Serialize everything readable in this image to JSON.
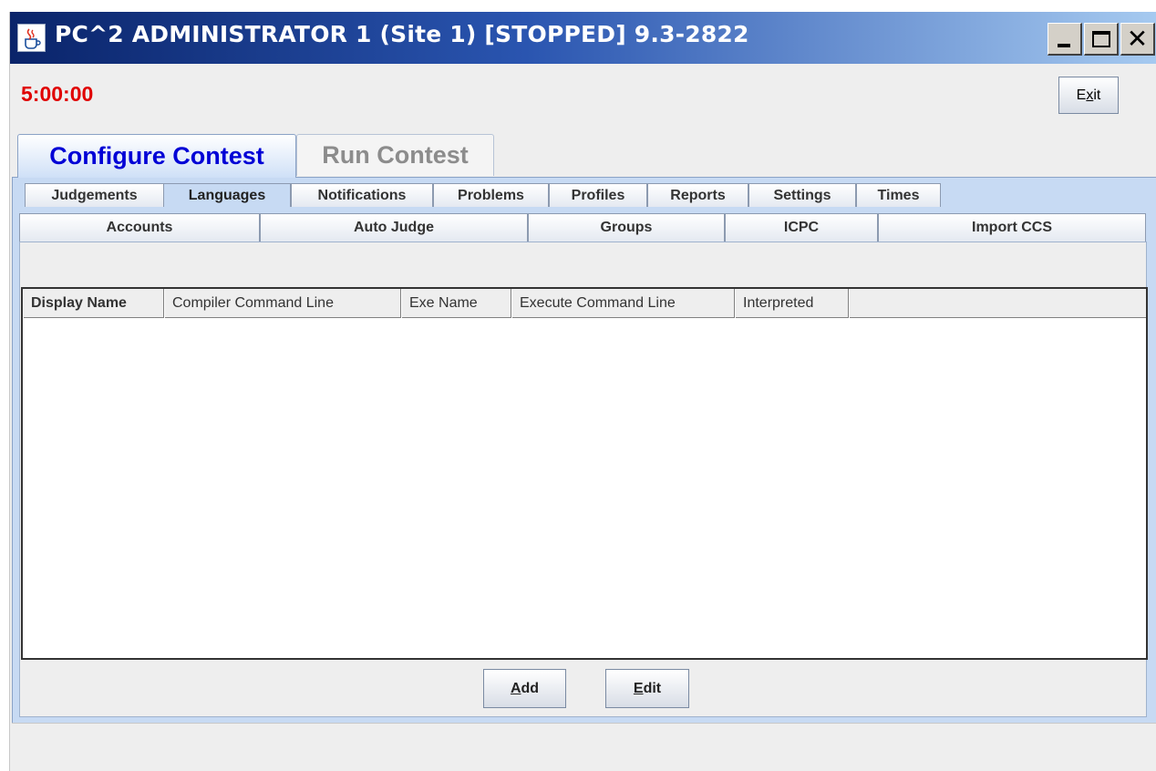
{
  "window": {
    "title": "PC^2 ADMINISTRATOR 1 (Site 1) [STOPPED] 9.3-2822",
    "minimize": "_",
    "close": "✕"
  },
  "header": {
    "clock": "5:00:00",
    "exit_prefix": "E",
    "exit_mnemonic": "x",
    "exit_suffix": "it"
  },
  "main_tabs": [
    "Configure Contest",
    "Run Contest"
  ],
  "subtabs_row1": [
    "Judgements",
    "Languages",
    "Notifications",
    "Problems",
    "Profiles",
    "Reports",
    "Settings",
    "Times"
  ],
  "subtabs_row2": [
    "Accounts",
    "Auto Judge",
    "Groups",
    "ICPC",
    "Import CCS"
  ],
  "table": {
    "columns": [
      "Display Name",
      "Compiler Command Line",
      "Exe Name",
      "Execute Command Line",
      "Interpreted",
      ""
    ]
  },
  "buttons": {
    "add_mnemonic": "A",
    "add_rest": "dd",
    "edit_mnemonic": "E",
    "edit_rest": "dit"
  },
  "colors": {
    "clock": "#e00000",
    "active_tab_text": "#0000d6",
    "panel_bg": "#c7daf3"
  }
}
